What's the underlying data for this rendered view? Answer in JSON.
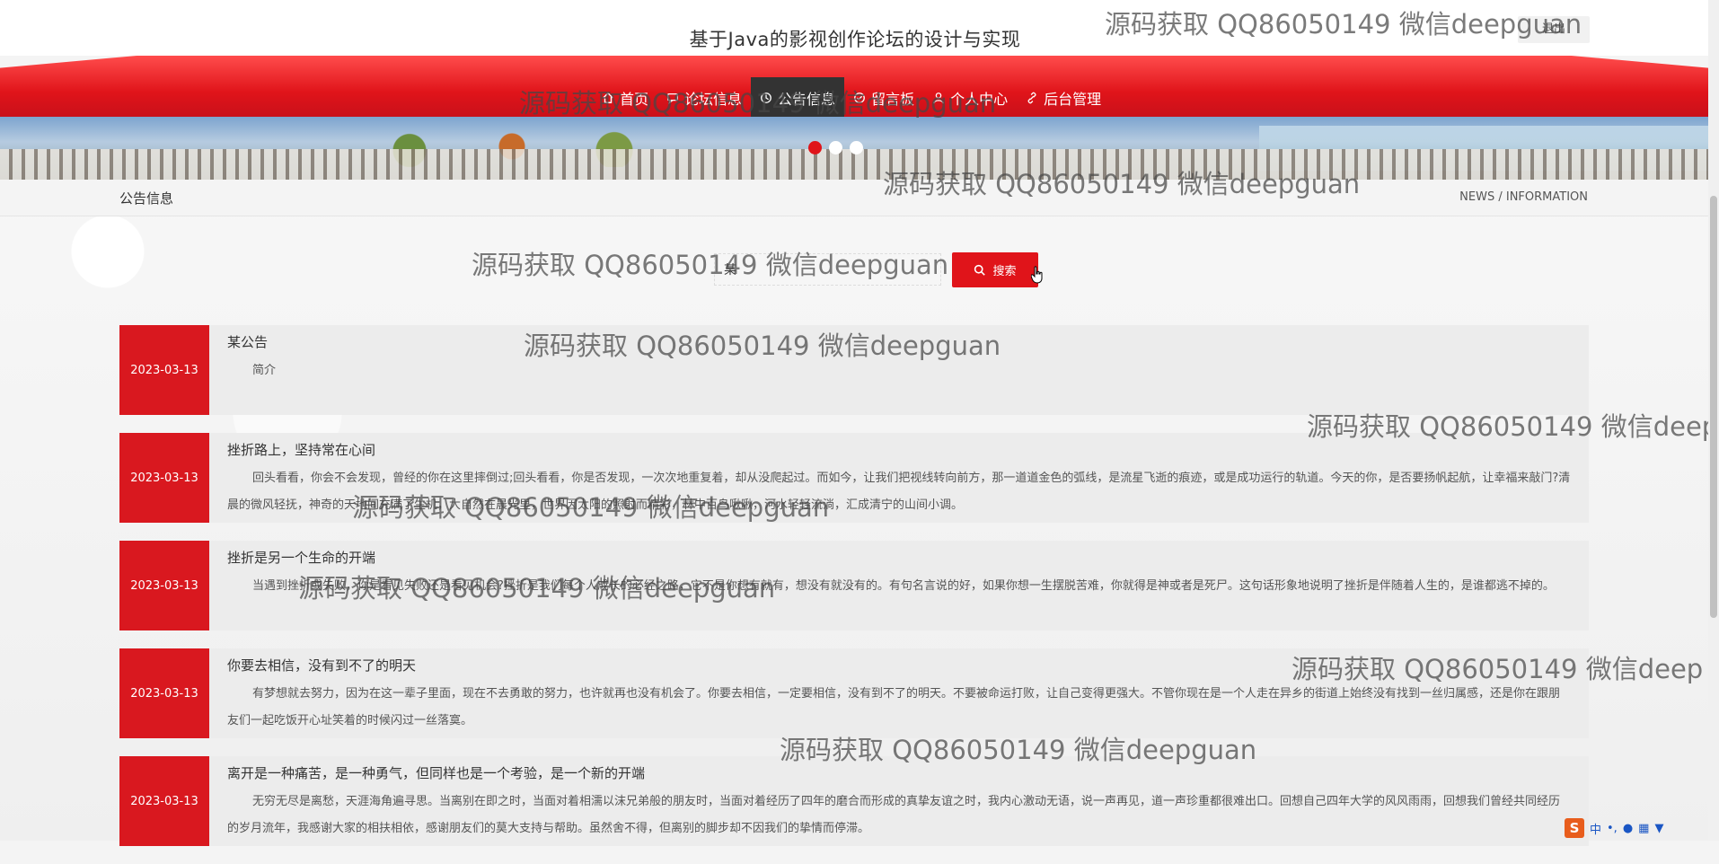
{
  "header": {
    "site_title": "基于Java的影视创作论坛的设计与实现",
    "logout_label": "退出"
  },
  "nav": {
    "items": [
      {
        "label": "首页",
        "icon": "home-icon"
      },
      {
        "label": "论坛信息",
        "icon": "forum-icon"
      },
      {
        "label": "公告信息",
        "icon": "clock-icon",
        "active": true
      },
      {
        "label": "留言板",
        "icon": "message-icon"
      },
      {
        "label": "个人中心",
        "icon": "user-icon"
      },
      {
        "label": "后台管理",
        "icon": "link-icon"
      }
    ]
  },
  "carousel": {
    "slide_count": 3,
    "active_index": 0
  },
  "section": {
    "title": "公告信息",
    "subtitle": "NEWS / INFORMATION"
  },
  "search": {
    "input_value": "某",
    "button_label": "搜索"
  },
  "news": [
    {
      "date": "2023-03-13",
      "title": "某公告",
      "summary": "简介"
    },
    {
      "date": "2023-03-13",
      "title": "挫折路上，坚持常在心间",
      "summary": "回头看看，你会不会发现，曾经的你在这里摔倒过;回头看看，你是否发现，一次次地重复着，却从没爬起过。而如今，让我们把视线转向前方，那一道道金色的弧线，是流星飞逝的痕迹，或是成功运行的轨道。今天的你，是否要扬帆起航，让幸福来敲门?清晨的微风轻抚，神奇的天地间充满了生机，大自然在晨光里，世界因太阳的照射而精彩，林中百鸟啾啾，河水轻轻流淌，汇成清宁的山间小调。"
    },
    {
      "date": "2023-03-13",
      "title": "挫折是另一个生命的开端",
      "summary": "当遇到挫折或失败，你是看见失败还是看见机会?挫折是我们每个人成长的必经之路，它不是你想有就有，想没有就没有的。有句名言说的好，如果你想一生摆脱苦难，你就得是神或者是死尸。这句话形象地说明了挫折是伴随着人生的，是谁都逃不掉的。"
    },
    {
      "date": "2023-03-13",
      "title": "你要去相信，没有到不了的明天",
      "summary": "有梦想就去努力，因为在这一辈子里面，现在不去勇敢的努力，也许就再也没有机会了。你要去相信，一定要相信，没有到不了的明天。不要被命运打败，让自己变得更强大。不管你现在是一个人走在异乡的街道上始终没有找到一丝归属感，还是你在跟朋友们一起吃饭开心址笑着的时候闪过一丝落寞。"
    },
    {
      "date": "2023-03-13",
      "title": "离开是一种痛苦，是一种勇气，但同样也是一个考验，是一个新的开端",
      "summary": "无穷无尽是离愁，天涯海角遍寻思。当离别在即之时，当面对着相濡以沫兄弟般的朋友时，当面对着经历了四年的磨合而形成的真挚友谊之时，我内心激动无语，说一声再见，道一声珍重都很难出口。回想自己四年大学的风风雨雨，回想我们曾经共同经历的岁月流年，我感谢大家的相扶相依，感谢朋友们的莫大支持与帮助。虽然舍不得，但离别的脚步却不因我们的挚情而停滞。"
    }
  ],
  "watermarks": [
    "源码获取 QQ86050149 微信deepguan",
    "源码获取 QQ86050149 微信deepguan",
    "源码获取 QQ86050149 微信deepguan",
    "源码获取 QQ86050149 微信deepguan",
    "源码获取 QQ86050149 微信deepguan",
    "源码获取 QQ86050149 微信deep",
    "源码获取 QQ86050149 微信deepguan",
    "源码获取 QQ86050149 微信deepguan",
    "源码获取 QQ86050149 微信deep",
    "源码获取 QQ86050149 微信deepguan"
  ],
  "taskbar": {
    "ime_label": "中"
  },
  "colors": {
    "accent": "#e0141a",
    "date_block": "#d9181f",
    "active_nav": "#333333"
  }
}
